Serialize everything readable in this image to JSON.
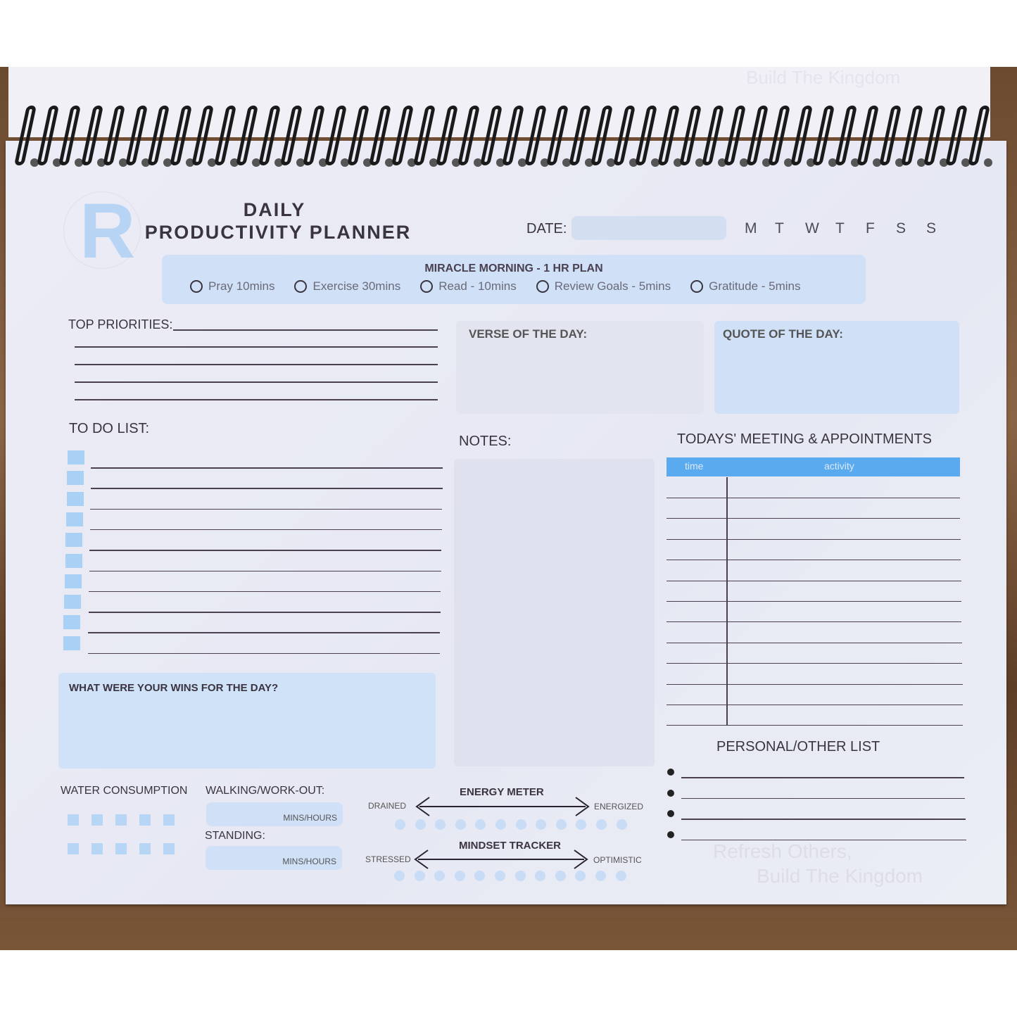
{
  "header": {
    "title_line1": "DAILY",
    "title_line2": "PRODUCTIVITY PLANNER",
    "date_label": "DATE:",
    "date_value": "",
    "days": [
      "M",
      "T",
      "W",
      "T",
      "F",
      "S",
      "S"
    ],
    "logo_letter": "R"
  },
  "miracle_morning": {
    "title": "MIRACLE MORNING - 1 HR PLAN",
    "items": [
      "Pray 10mins",
      "Exercise 30mins",
      "Read - 10mins",
      "Review Goals - 5mins",
      "Gratitude - 5mins"
    ]
  },
  "top_priorities": {
    "label": "TOP PRIORITIES:"
  },
  "verse": {
    "label": "VERSE OF THE DAY:"
  },
  "quote": {
    "label": "QUOTE OF THE DAY:"
  },
  "todo": {
    "label": "TO DO LIST:",
    "count": 10
  },
  "notes": {
    "label": "NOTES:"
  },
  "meetings": {
    "label": "TODAYS' MEETING & APPOINTMENTS",
    "col_time": "time",
    "col_activity": "activity",
    "rows": 12
  },
  "wins": {
    "label": "WHAT WERE YOUR WINS FOR THE DAY?"
  },
  "water": {
    "label": "WATER CONSUMPTION",
    "cups": 10
  },
  "walking": {
    "label": "WALKING/WORK-OUT:",
    "unit": "MINS/HOURS"
  },
  "standing": {
    "label": "STANDING:",
    "unit": "MINS/HOURS"
  },
  "energy": {
    "title": "ENERGY METER",
    "left": "DRAINED",
    "right": "ENERGIZED",
    "dots": 12
  },
  "mindset": {
    "title": "MINDSET TRACKER",
    "left": "STRESSED",
    "right": "OPTIMISTIC",
    "dots": 12
  },
  "personal": {
    "label": "PERSONAL/OTHER LIST",
    "items": 4
  },
  "watermark": {
    "line1": "Refresh Others,",
    "line2": "Build The Kingdom"
  },
  "back_page": {
    "text": "Build The Kingdom"
  },
  "colors": {
    "accent": "#5aaaf0",
    "panel": "#cfe0f7",
    "ink": "#3a3440"
  }
}
